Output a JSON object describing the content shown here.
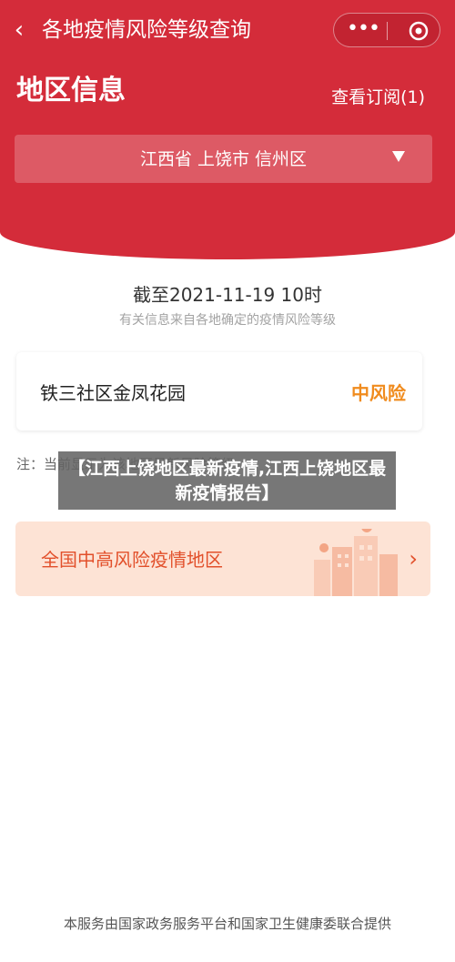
{
  "nav": {
    "back_icon": "chevron-left-icon",
    "title": "各地疫情风险等级查询",
    "menu_icon": "more-dots-icon",
    "close_icon": "target-circle-icon"
  },
  "header": {
    "region_title": "地区信息",
    "subscribe_link": "查看订阅(1)",
    "region_select_value": "江西省 上饶市 信州区",
    "accent_color": "#d42c3a"
  },
  "status": {
    "as_of": "截至2021-11-19 10时",
    "source_note": "有关信息来自各地确定的疫情风险等级"
  },
  "area": {
    "name": "铁三社区金凤花园",
    "risk_level": "中风险",
    "risk_color": "#f08b1d"
  },
  "note": {
    "text": "注：当前显示为该地区最新风险等级"
  },
  "overlay": {
    "text": "【江西上饶地区最新疫情,江西上饶地区最新疫情报告】"
  },
  "risk_areas": {
    "label": "全国中高风险疫情地区",
    "chevron_icon": "chevron-right-icon"
  },
  "footer": {
    "text": "本服务由国家政务服务平台和国家卫生健康委联合提供"
  }
}
